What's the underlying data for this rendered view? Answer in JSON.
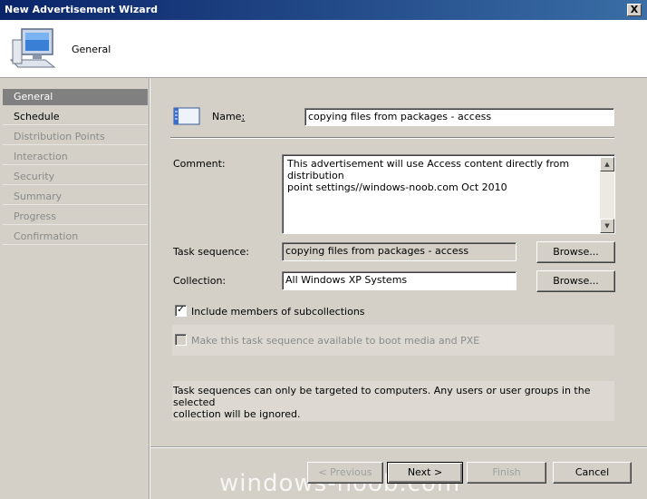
{
  "window": {
    "title": "New Advertisement Wizard",
    "close_label": "X"
  },
  "header": {
    "title": "General",
    "icon": "computer-monitor-icon"
  },
  "sidebar": {
    "items": [
      {
        "label": "General",
        "state": "active"
      },
      {
        "label": "Schedule",
        "state": "done"
      },
      {
        "label": "Distribution Points",
        "state": "pending"
      },
      {
        "label": "Interaction",
        "state": "pending"
      },
      {
        "label": "Security",
        "state": "pending"
      },
      {
        "label": "Summary",
        "state": "pending"
      },
      {
        "label": "Progress",
        "state": "pending"
      },
      {
        "label": "Confirmation",
        "state": "pending"
      }
    ]
  },
  "form": {
    "name_label_pre": "Name",
    "name_label_colon": ":",
    "name_value": "copying files from packages - access",
    "comment_label": "Comment:",
    "comment_line1": "This advertisement will use Access content directly from distribution",
    "comment_line2": "point settings//windows-noob.com Oct 2010",
    "task_sequence_label": "Task sequence:",
    "task_sequence_value": "copying files from packages - access",
    "collection_label": "Collection:",
    "collection_value": "All Windows XP Systems",
    "browse_label": "Browse...",
    "include_subcollections_label": "Include members of subcollections",
    "include_subcollections_checked": true,
    "boot_media_label": "Make this task sequence available to boot media and PXE",
    "boot_media_checked": false,
    "info_line1": "Task sequences can only be targeted to computers.  Any users or user groups in the selected",
    "info_line2": "collection will be ignored."
  },
  "footer": {
    "previous_label": "< Previous",
    "next_label": "Next >",
    "finish_label": "Finish",
    "cancel_label": "Cancel",
    "watermark": "windows-noob.com"
  }
}
